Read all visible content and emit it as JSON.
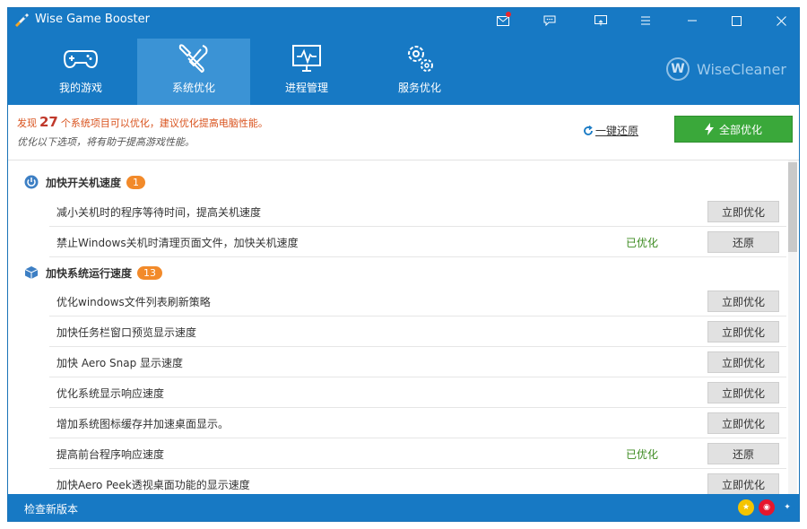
{
  "app": {
    "title": "Wise Game Booster"
  },
  "brand": {
    "letter": "W",
    "name": "WiseCleaner"
  },
  "nav": {
    "tabs": [
      {
        "label": "我的游戏",
        "icon": "gamepad-icon",
        "active": false
      },
      {
        "label": "系统优化",
        "icon": "tools-icon",
        "active": true
      },
      {
        "label": "进程管理",
        "icon": "monitor-icon",
        "active": false
      },
      {
        "label": "服务优化",
        "icon": "gears-icon",
        "active": false
      }
    ]
  },
  "summary": {
    "prefix": "发现",
    "count": "27",
    "suffix": "个系统项目可以优化，建议优化提高电脑性能。",
    "hint": "优化以下选项，将有助于提高游戏性能。",
    "restore_all": "一键还原",
    "optimize_all": "全部优化"
  },
  "sections": [
    {
      "title": "加快开关机速度",
      "badge": "1",
      "icon": "power-icon",
      "items": [
        {
          "text": "减小关机时的程序等待时间，提高关机速度",
          "status": "",
          "action": "立即优化"
        },
        {
          "text": "禁止Windows关机时清理页面文件，加快关机速度",
          "status": "已优化",
          "action": "还原"
        }
      ]
    },
    {
      "title": "加快系统运行速度",
      "badge": "13",
      "icon": "cube-icon",
      "items": [
        {
          "text": "优化windows文件列表刷新策略",
          "status": "",
          "action": "立即优化"
        },
        {
          "text": "加快任务栏窗口预览显示速度",
          "status": "",
          "action": "立即优化"
        },
        {
          "text": "加快 Aero Snap 显示速度",
          "status": "",
          "action": "立即优化"
        },
        {
          "text": "优化系统显示响应速度",
          "status": "",
          "action": "立即优化"
        },
        {
          "text": "增加系统图标缓存并加速桌面显示。",
          "status": "",
          "action": "立即优化"
        },
        {
          "text": "提高前台程序响应速度",
          "status": "已优化",
          "action": "还原"
        },
        {
          "text": "加快Aero Peek透视桌面功能的显示速度",
          "status": "",
          "action": "立即优化"
        }
      ]
    }
  ],
  "statusbar": {
    "check_update": "检查新版本"
  },
  "colors": {
    "primary": "#1779c4",
    "active_tab": "#3b93d5",
    "accent_green": "#3aa83a",
    "badge": "#f28a2a",
    "optimized": "#3b8a1f"
  }
}
